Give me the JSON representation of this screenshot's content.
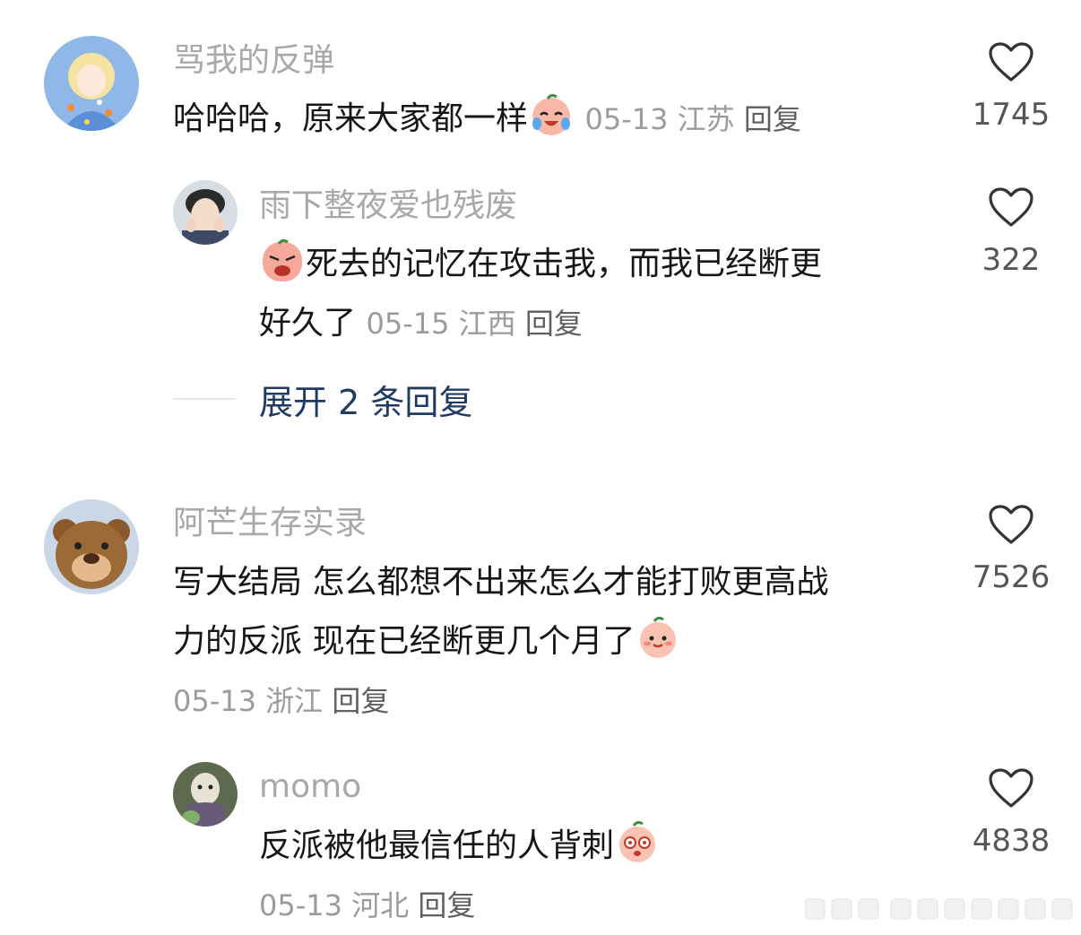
{
  "comments": [
    {
      "user": "骂我的反弹",
      "text": "哈哈哈，原来大家都一样",
      "date": "05-13",
      "location": "江苏",
      "reply_label": "回复",
      "likes": "1745",
      "emoji": "crying-laugh-emoji"
    },
    {
      "user": "雨下整夜爱也残废",
      "text": "死去的记忆在攻击我，而我已经断更好久了",
      "text_line1": "死去的记忆在攻击我，而我已经断更",
      "text_line2": "好久了",
      "date": "05-15",
      "location": "江西",
      "reply_label": "回复",
      "likes": "322",
      "emoji": "upset-emoji"
    },
    {
      "user": "阿芒生存实录",
      "text_line1": "写大结局 怎么都想不出来怎么才能打败更高战",
      "text_line2": "力的反派 现在已经断更几个月了",
      "date": "05-13",
      "location": "浙江",
      "reply_label": "回复",
      "likes": "7526",
      "emoji": "blush-emoji"
    },
    {
      "user": "momo",
      "text": "反派被他最信任的人背刺",
      "date": "05-13",
      "location": "河北",
      "reply_label": "回复",
      "likes": "4838",
      "emoji": "shocked-emoji"
    }
  ],
  "expand_replies": "展开 2 条回复",
  "colors": {
    "username": "#a8a8a8",
    "text": "#161616",
    "meta": "#9b9b9b",
    "expand": "#1f3b63",
    "heart": "#333333"
  }
}
